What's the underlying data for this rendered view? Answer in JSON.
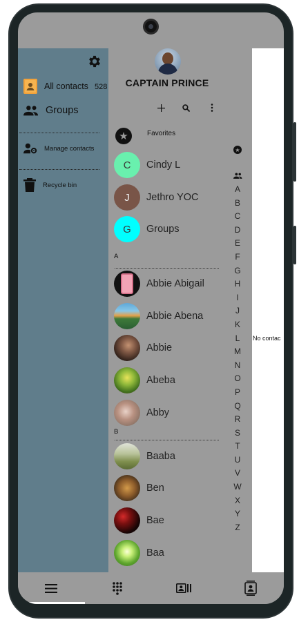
{
  "drawer": {
    "all_contacts_label": "All contacts",
    "all_contacts_count": "528",
    "groups_label": "Groups",
    "manage_contacts_label": "Manage contacts",
    "recycle_bin_label": "Recycle bin"
  },
  "profile": {
    "name": "CAPTAIN PRINCE"
  },
  "favorites_label": "Favorites",
  "favorites": [
    {
      "initial": "C",
      "name": "Cindy L",
      "color": "#69f0ae"
    },
    {
      "initial": "J",
      "name": "Jethro YOC",
      "color": "#795548"
    },
    {
      "initial": "G",
      "name": "Groups",
      "color": "#00ffff"
    }
  ],
  "sections": [
    {
      "letter": "A",
      "contacts": [
        {
          "name": "Abbie Abigail",
          "photo": "pink-phone"
        },
        {
          "name": "Abbie Abena",
          "photo": "landscape"
        },
        {
          "name": "Abbie",
          "photo": "person-dark"
        },
        {
          "name": "Abeba",
          "photo": "tree"
        },
        {
          "name": "Abby",
          "photo": "person-light"
        }
      ]
    },
    {
      "letter": "B",
      "contacts": [
        {
          "name": "Baaba",
          "photo": "field"
        },
        {
          "name": "Ben",
          "photo": "tiger"
        },
        {
          "name": "Bae",
          "photo": "red-dots"
        },
        {
          "name": "Baa",
          "photo": "sunlit-forest"
        }
      ]
    }
  ],
  "alphabet": [
    "A",
    "B",
    "C",
    "D",
    "E",
    "F",
    "G",
    "H",
    "I",
    "J",
    "K",
    "L",
    "M",
    "N",
    "O",
    "P",
    "Q",
    "R",
    "S",
    "T",
    "U",
    "V",
    "W",
    "X",
    "Y",
    "Z"
  ],
  "empty_message": "No contac"
}
